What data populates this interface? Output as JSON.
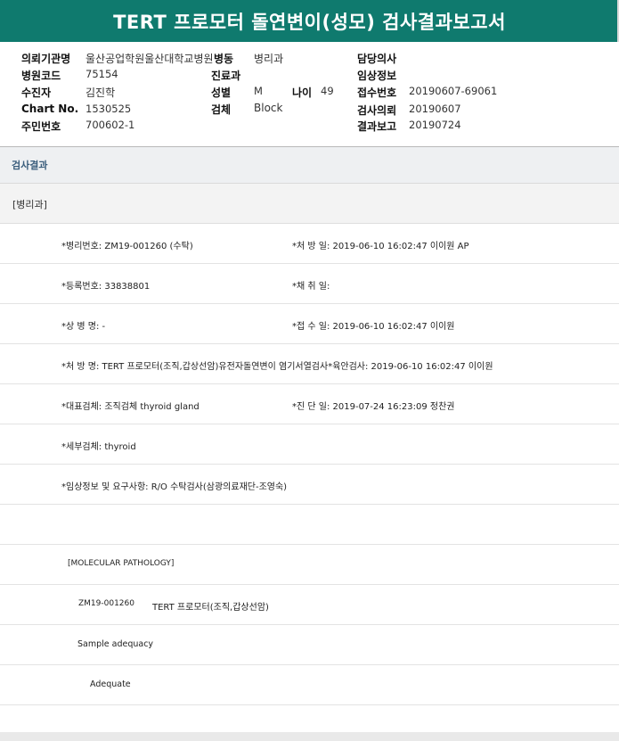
{
  "title": "TERT 프로모터 돌연변이(성모) 검사결과보고서",
  "header": {
    "institution_label": "의뢰기관명",
    "institution_value": "울산공업학원울산대학교병원",
    "ward_label": "병동",
    "ward_value": "병리과",
    "attending_label": "담당의사",
    "hospital_code_label": "병원코드",
    "hospital_code_value": "75154",
    "dept_label": "진료과",
    "clinical_info_label": "임상정보",
    "patient_label": "수진자",
    "patient_value": "김진학",
    "sex_label": "성별",
    "sex_value": "M",
    "age_label": "나이",
    "age_value": "49",
    "receipt_no_label": "접수번호",
    "receipt_no_value": "20190607-69061",
    "chart_label": "Chart No.",
    "chart_value": "1530525",
    "specimen_label": "검체",
    "specimen_value": "Block",
    "request_label": "검사의뢰",
    "request_value": "20190607",
    "rrn_label": "주민번호",
    "rrn_value": "700602-1",
    "report_label": "결과보고",
    "report_value": "20190724"
  },
  "section": {
    "title": "검사결과",
    "subtitle": "[병리과]"
  },
  "rows": {
    "r1_left": "*병리번호: ZM19-001260 (수탁)",
    "r1_right": "*처 방 일: 2019-06-10 16:02:47  이이원 AP",
    "r2_left": "*등록번호: 33838801",
    "r2_right": "*채 취 일:",
    "r3_left": "*상 병 명: -",
    "r3_right": "*접 수 일: 2019-06-10 16:02:47  이이원",
    "r4_left": "*처 방 명: TERT 프로모터(조직,갑상선암)유전자돌연변이 염기서열검사*육안검사: 2019-06-10 16:02:47  이이원",
    "r5_left": "*대표검체: 조직검체 thyroid gland",
    "r5_right": "*진 단 일: 2019-07-24 16:23:09  정찬권",
    "r6_left": "*세부검체: thyroid",
    "r7_left": "*임상정보 및 요구사항: R/O 수탁검사(삼광의료재단-조영숙)",
    "r9_left": "[MOLECULAR PATHOLOGY]",
    "r10_left": "ZM19-001260",
    "r10_right": "TERT 프로모터(조직,갑상선암)",
    "r11_left": "Sample adequacy",
    "r12_left": "Adequate"
  }
}
